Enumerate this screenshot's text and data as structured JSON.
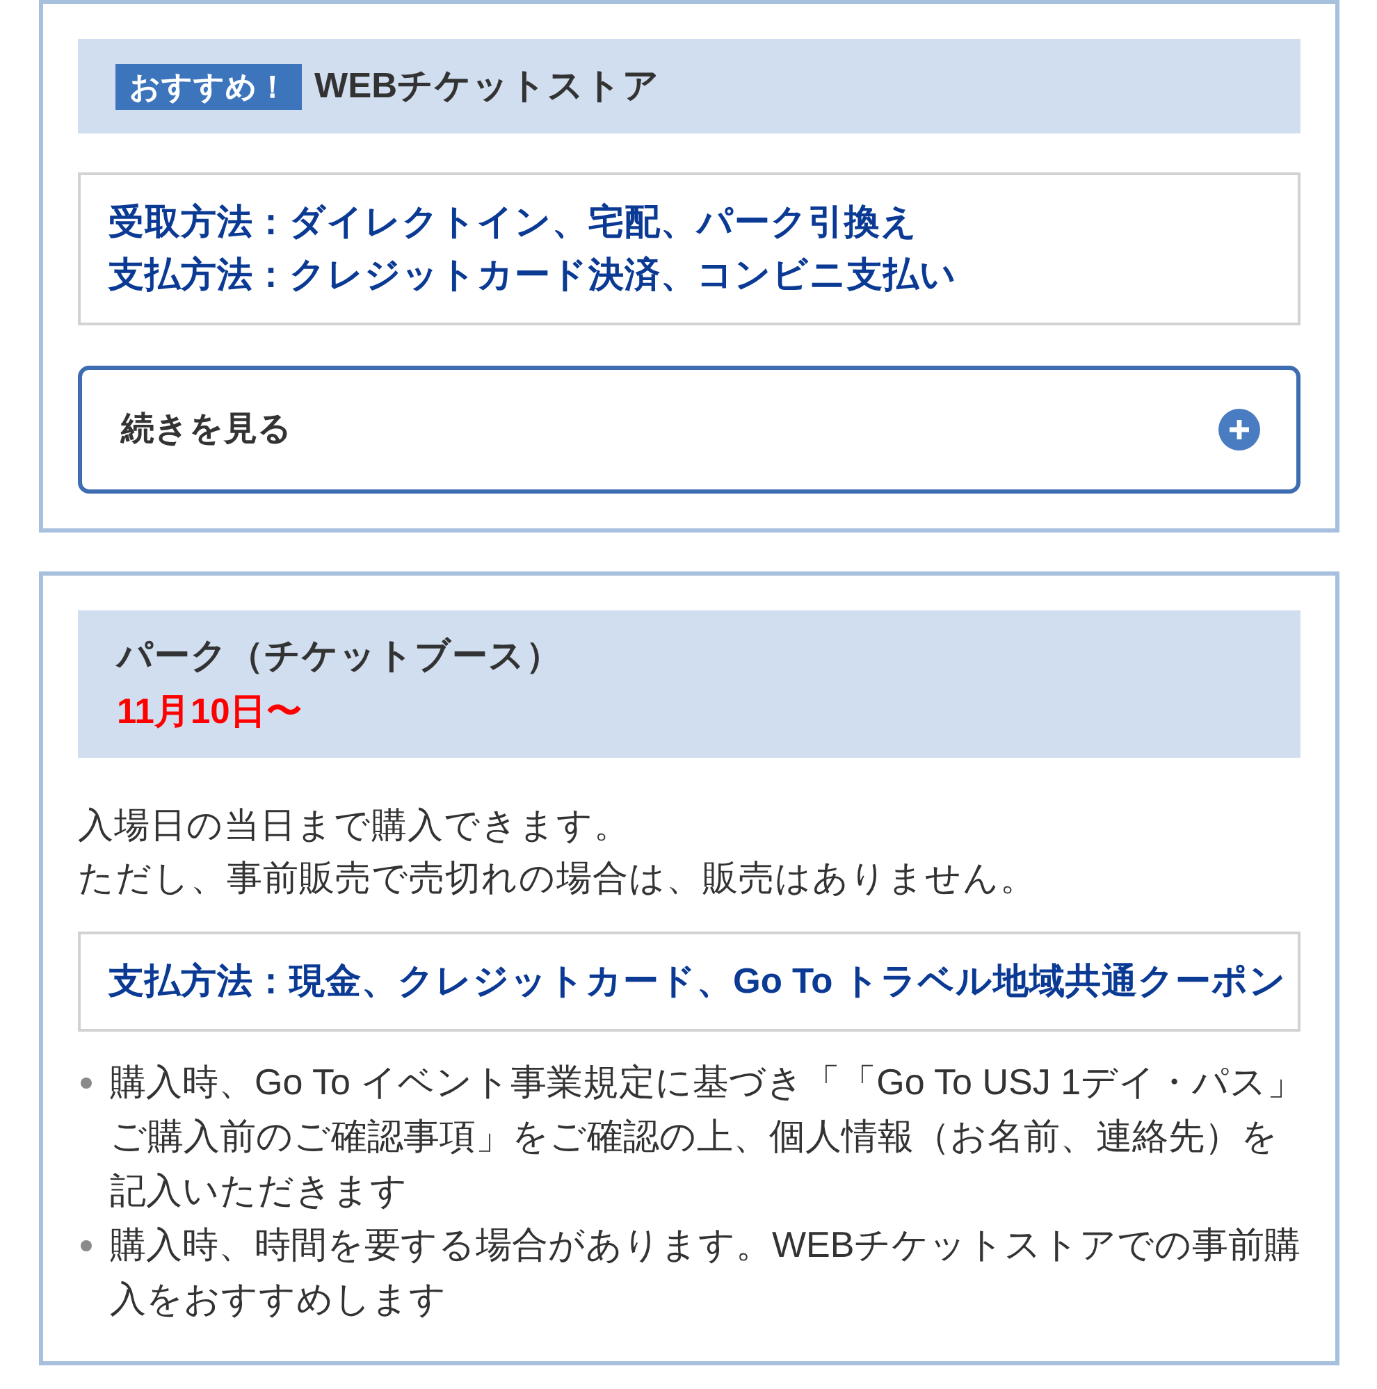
{
  "cards": [
    {
      "badge": "おすすめ！",
      "title": "WEBチケットストア",
      "info_lines": [
        "受取方法：ダイレクトイン、宅配、パーク引換え",
        "支払方法：クレジットカード決済、コンビニ支払い"
      ],
      "more_button": {
        "label": "続きを見る",
        "expanded": false
      }
    },
    {
      "title": "パーク（チケットブース）",
      "date": "11月10日〜",
      "description_lines": [
        "入場日の当日まで購入できます。",
        "ただし、事前販売で売切れの場合は、販売はありません。"
      ],
      "info_lines": [
        "支払方法：現金、クレジットカード、Go To トラベル地域共通クーポン"
      ],
      "notes": [
        "購入時、Go To イベント事業規定に基づき「「Go To USJ 1デイ・パス」ご購入前のご確認事項」をご確認の上、個人情報（お名前、連絡先）を記入いただきます",
        "購入時、時間を要する場合があります。WEBチケットストアでの事前購入をおすすめします"
      ]
    }
  ]
}
